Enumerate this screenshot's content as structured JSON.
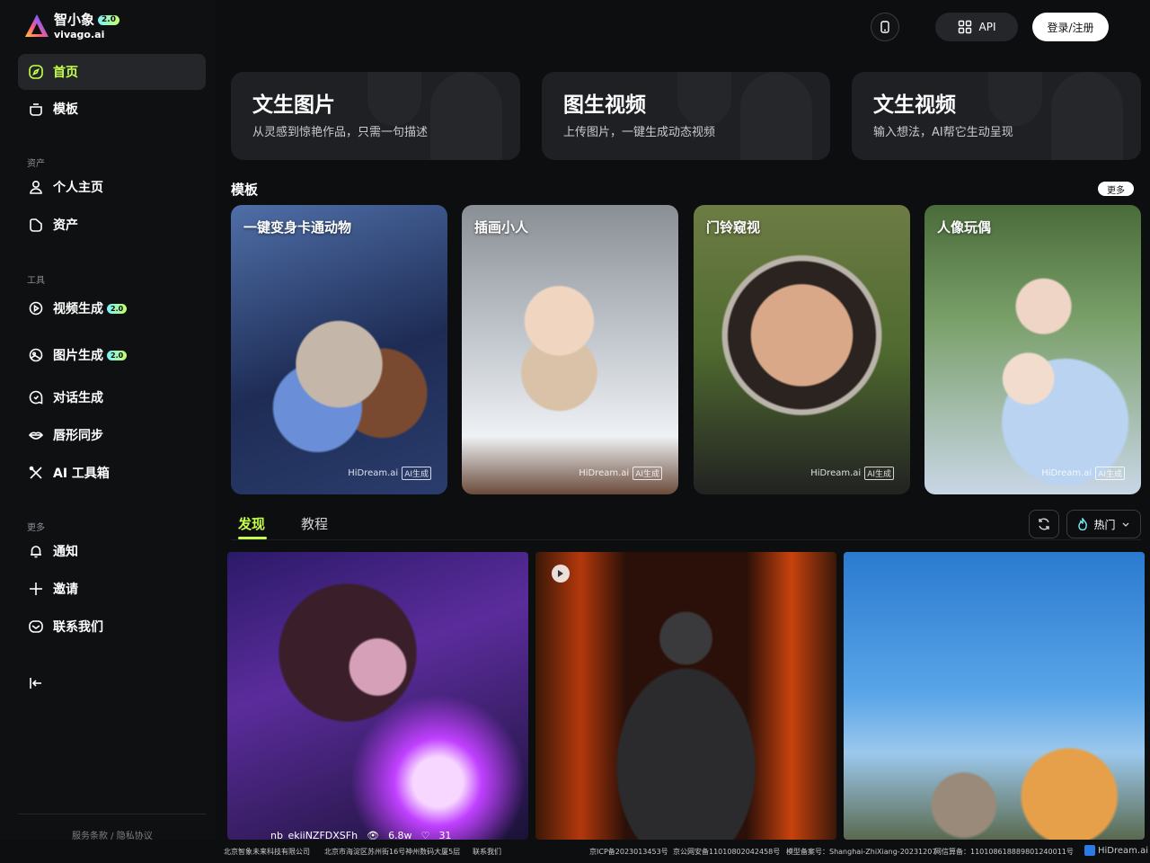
{
  "brand": {
    "name_cn": "智小象",
    "version": "2.0",
    "name_en": "vivago.ai"
  },
  "sidebar": {
    "home": "首页",
    "templates": "模板",
    "section_assets": "资产",
    "profile": "个人主页",
    "assets": "资产",
    "section_tools": "工具",
    "video_gen": "视频生成",
    "video_badge": "2.0",
    "image_gen": "图片生成",
    "image_badge": "2.0",
    "chat_gen": "对话生成",
    "lip_sync": "唇形同步",
    "ai_toolbox": "AI 工具箱",
    "section_more": "更多",
    "notifications": "通知",
    "invite": "邀请",
    "contact": "联系我们",
    "footer_links": "服务条款 / 隐私协议"
  },
  "topbar": {
    "api_label": "API",
    "login_label": "登录/注册"
  },
  "features": [
    {
      "title": "文生图片",
      "subtitle": "从灵感到惊艳作品，只需一句描述"
    },
    {
      "title": "图生视频",
      "subtitle": "上传图片，一键生成动态视频"
    },
    {
      "title": "文生视频",
      "subtitle": "输入想法，AI帮它生动呈现"
    }
  ],
  "templates": {
    "title": "模板",
    "more": "更多",
    "items": [
      {
        "title": "一键变身卡通动物",
        "watermark": "HiDream.ai",
        "ai_tag": "AI生成"
      },
      {
        "title": "插画小人",
        "watermark": "HiDream.ai",
        "ai_tag": "AI生成"
      },
      {
        "title": "门铃窥视",
        "watermark": "HiDream.ai",
        "ai_tag": "AI生成"
      },
      {
        "title": "人像玩偶",
        "watermark": "HiDream.ai",
        "ai_tag": "AI生成"
      }
    ]
  },
  "feed": {
    "tabs": [
      "发现",
      "教程"
    ],
    "sort_label": "热门",
    "cards": [
      {
        "user": "nb_ekiiNZFDXSFh",
        "views": "6.8w",
        "likes": "31"
      }
    ]
  },
  "footer": {
    "company": "北京智象未来科技有限公司",
    "address": "北京市海淀区苏州街16号神州数码大厦5层",
    "contact": "联系我们",
    "icp": "京ICP备2023013453号",
    "police": "京公网安备11010802042458号",
    "model_record": "模型备案号：Shanghai-ZhiXiang-20231207",
    "net_record": "网信算备：110108618889801240011号",
    "brand": "HiDream.ai"
  }
}
